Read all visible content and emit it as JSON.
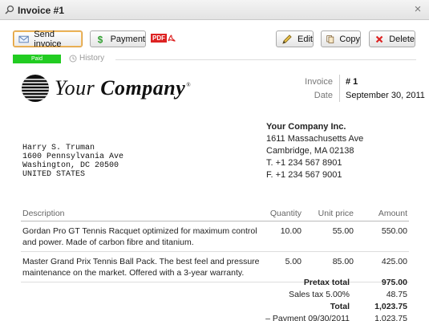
{
  "window": {
    "title": "Invoice #1",
    "icon": "search-icon",
    "close_glyph": "×"
  },
  "toolbar": {
    "send_invoice": "Send invoice",
    "payment": "Payment",
    "pdf": "PDF",
    "edit": "Edit",
    "copy": "Copy",
    "delete": "Delete"
  },
  "status": {
    "paid": "Paid",
    "history": "History",
    "paid_color": "#22cc22"
  },
  "company_logo": {
    "word1": "Your",
    "word2": "Company",
    "reg": "®"
  },
  "invoice_meta": {
    "invoice_label": "Invoice",
    "invoice_value": "# 1",
    "date_label": "Date",
    "date_value": "September 30, 2011"
  },
  "from": {
    "company": "Your Company Inc.",
    "street": "1611 Massachusetts Ave",
    "city": "Cambridge, MA  02138",
    "phone": "T. +1 234 567 8901",
    "fax": "F. +1 234 567 9001"
  },
  "to": {
    "name": "Harry S. Truman",
    "street": "1600 Pennsylvania Ave",
    "city": "Washington, DC  20500",
    "country": "UNITED STATES"
  },
  "items": {
    "headers": {
      "description": "Description",
      "quantity": "Quantity",
      "unit_price": "Unit price",
      "amount": "Amount"
    },
    "rows": [
      {
        "description": "Gordan Pro GT Tennis Racquet optimized for maximum control and power. Made of carbon fibre and titanium.",
        "quantity": "10.00",
        "unit_price": "55.00",
        "amount": "550.00"
      },
      {
        "description": "Master Grand Prix Tennis Ball Pack.  The best feel and pressure maintenance on the market. Offered with a 3-year warranty.",
        "quantity": "5.00",
        "unit_price": "85.00",
        "amount": "425.00"
      }
    ]
  },
  "totals": {
    "pretax_label": "Pretax total",
    "pretax_value": "975.00",
    "tax_label": "Sales tax 5.00%",
    "tax_value": "48.75",
    "total_label": "Total",
    "total_value": "1,023.75",
    "payment_label": "– Payment 09/30/2011",
    "payment_value": "1,023.75"
  }
}
